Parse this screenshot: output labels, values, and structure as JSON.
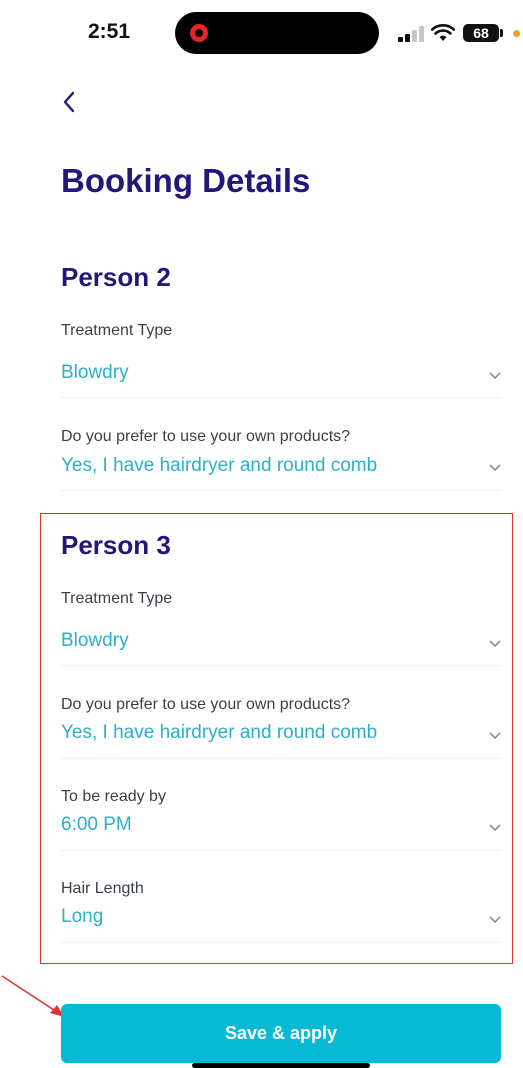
{
  "status_bar": {
    "time": "2:51",
    "battery": "68",
    "icons": [
      "screen-record-icon",
      "signal-icon",
      "wifi-icon",
      "battery-icon"
    ]
  },
  "header": {
    "back_icon": "chevron-left-icon",
    "title": "Booking Details"
  },
  "person2": {
    "heading": "Person 2",
    "treatment_label": "Treatment Type",
    "treatment_value": "Blowdry",
    "products_label": "Do you prefer to use your own products?",
    "products_value": "Yes, I have hairdryer and round comb"
  },
  "person3": {
    "heading": "Person 3",
    "treatment_label": "Treatment Type",
    "treatment_value": "Blowdry",
    "products_label": "Do you prefer to use your own products?",
    "products_value": "Yes, I have hairdryer and round comb",
    "ready_label": "To be ready by",
    "ready_value": "6:00 PM",
    "hair_label": "Hair Length",
    "hair_value": "Long"
  },
  "save_button": "Save & apply",
  "colors": {
    "title": "#22177a",
    "value": "#2bb0c8",
    "button": "#08b9d6",
    "highlight": "#e0322f"
  }
}
